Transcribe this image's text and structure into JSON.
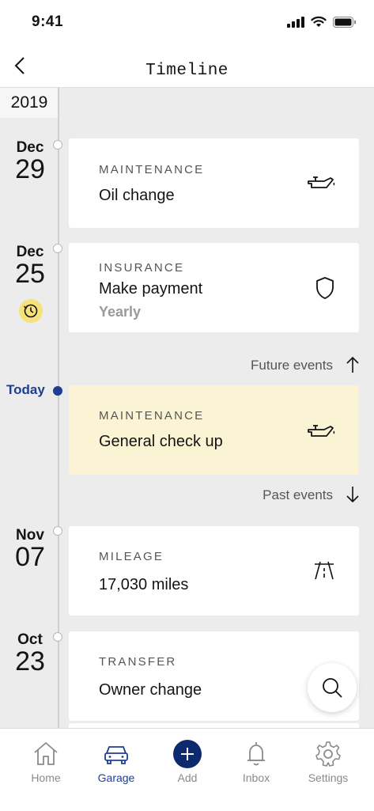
{
  "status_bar": {
    "time": "9:41"
  },
  "header": {
    "title": "Timeline"
  },
  "timeline": {
    "year": "2019",
    "today_label": "Today",
    "future_label": "Future events",
    "past_label": "Past events",
    "events": [
      {
        "month": "Dec",
        "day": "29",
        "category": "MAINTENANCE",
        "title": "Oil change",
        "icon": "oil-can-icon"
      },
      {
        "month": "Dec",
        "day": "25",
        "category": "INSURANCE",
        "title": "Make payment",
        "subtitle": "Yearly",
        "icon": "shield-icon",
        "badge_icon": "recurring-clock-icon"
      },
      {
        "category": "MAINTENANCE",
        "title": "General check up",
        "icon": "oil-can-icon",
        "highlight": "#fbf4d4"
      },
      {
        "month": "Nov",
        "day": "07",
        "category": "MILEAGE",
        "title": "17,030 miles",
        "icon": "road-icon"
      },
      {
        "month": "Oct",
        "day": "23",
        "category": "TRANSFER",
        "title": "Owner change"
      }
    ]
  },
  "tabbar": {
    "items": [
      {
        "label": "Home",
        "icon": "home-icon"
      },
      {
        "label": "Garage",
        "icon": "car-icon",
        "active": true
      },
      {
        "label": "Add",
        "icon": "plus-icon"
      },
      {
        "label": "Inbox",
        "icon": "bell-icon"
      },
      {
        "label": "Settings",
        "icon": "gear-icon"
      }
    ]
  },
  "colors": {
    "accent": "#1c3f94",
    "today_highlight": "#fbf4d4",
    "badge": "#f5e27a",
    "background": "#ececec"
  }
}
